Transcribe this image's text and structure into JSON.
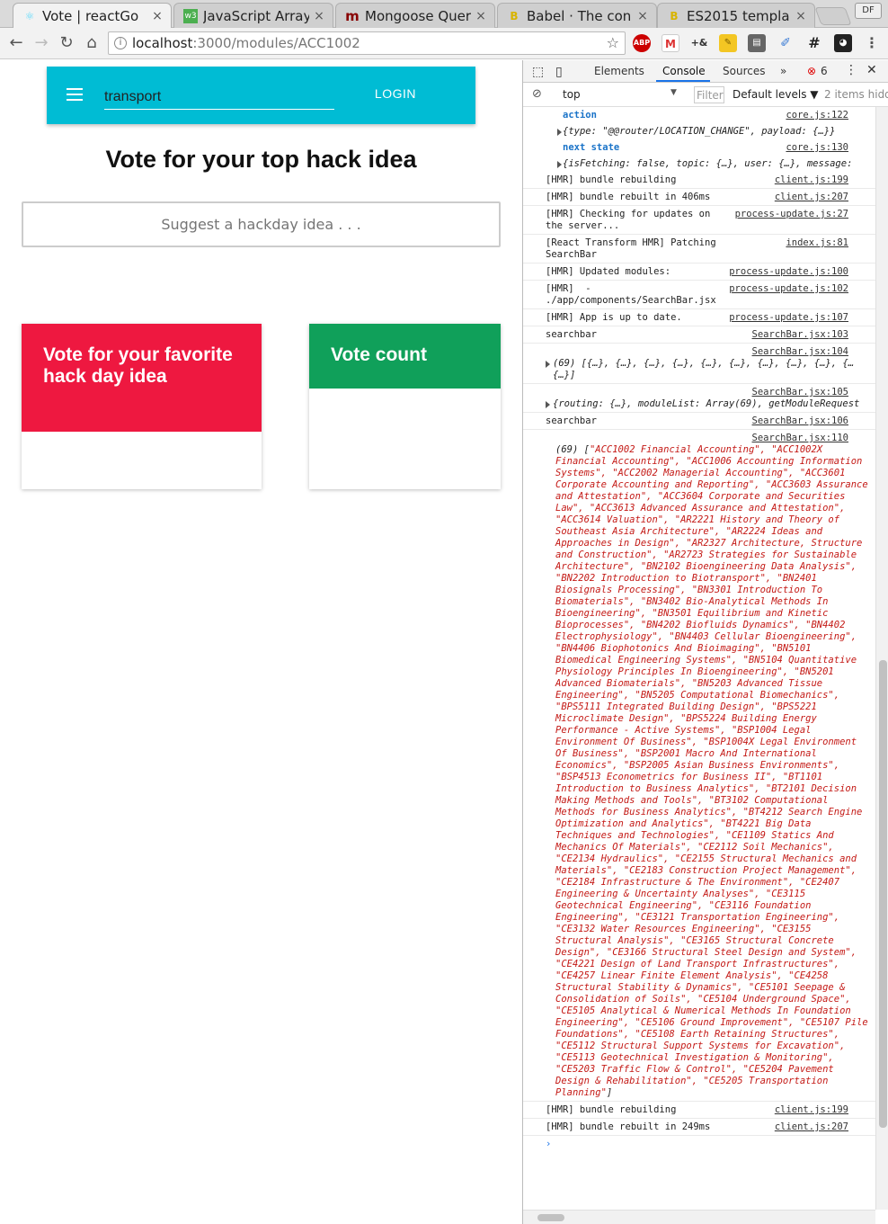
{
  "browser": {
    "tabs": [
      {
        "title": "Vote | reactGo",
        "icon": "react-icon",
        "color": "#61dafb"
      },
      {
        "title": "JavaScript Array",
        "icon": "w3-icon",
        "color": "#4caf50"
      },
      {
        "title": "Mongoose Quer",
        "icon": "mongoose-icon",
        "color": "#880000"
      },
      {
        "title": "Babel · The con",
        "icon": "babel-icon",
        "color": "#f5da55"
      },
      {
        "title": "ES2015 templa",
        "icon": "babel-icon",
        "color": "#f5da55"
      }
    ],
    "profile": "DF",
    "url_host": "localhost",
    "url_path": ":3000/modules/ACC1002"
  },
  "page": {
    "search_value": "transport",
    "login_label": "LOGIN",
    "heading": "Vote for your top hack idea",
    "idea_placeholder": "Suggest a hackday idea . . .",
    "card_ideas_title": "Vote for your favorite hack day idea",
    "card_count_title": "Vote count"
  },
  "devtools": {
    "tabs": [
      "Elements",
      "Console",
      "Sources",
      "»"
    ],
    "active_tab": "Console",
    "error_count": "6",
    "context": "top",
    "filter_placeholder": "Filter",
    "levels": "Default levels ▼",
    "hidden": "2 items hidd",
    "log": [
      {
        "msg": "action",
        "src": "core.js:122",
        "style": "blue",
        "indent": true
      },
      {
        "msg": "{type: \"@@router/LOCATION_CHANGE\", payload: {…}}",
        "src": "",
        "style": "it",
        "indent": true,
        "tri": true
      },
      {
        "msg": "next state",
        "src": "core.js:130",
        "style": "blue",
        "indent": true
      },
      {
        "msg": "{isFetching: false, topic: {…}, user: {…}, message:",
        "src": "",
        "style": "it",
        "indent": true,
        "tri": true
      },
      {
        "msg": "[HMR] bundle rebuilding",
        "src": "client.js:199"
      },
      {
        "msg": "[HMR] bundle rebuilt in 406ms",
        "src": "client.js:207"
      },
      {
        "msg": "[HMR] Checking for updates on\nthe server...",
        "src": "process-update.js:27"
      },
      {
        "msg": "[React Transform HMR] Patching\nSearchBar",
        "src": "index.js:81"
      },
      {
        "msg": "[HMR] Updated modules:",
        "src": "process-update.js:100"
      },
      {
        "msg": "[HMR]  -\n./app/components/SearchBar.jsx",
        "src": "process-update.js:102"
      },
      {
        "msg": "[HMR] App is up to date.",
        "src": "process-update.js:107"
      },
      {
        "msg": "searchbar",
        "src": "SearchBar.jsx:103"
      },
      {
        "msg": "\n(69) [{…}, {…}, {…}, {…}, {…}, {…}, {…}, {…}, {…}, {…\n{…}]",
        "src": "SearchBar.jsx:104",
        "style": "it",
        "tri": true
      },
      {
        "msg": "\n{routing: {…}, moduleList: Array(69), getModuleRequest",
        "src": "SearchBar.jsx:105",
        "style": "it",
        "tri": true
      },
      {
        "msg": "searchbar",
        "src": "SearchBar.jsx:106"
      }
    ],
    "big_log_src": "SearchBar.jsx:110",
    "big_log_prefix": "(69) [",
    "big_log_items": "\"ACC1002 Financial Accounting\", \"ACC1002X Financial Accounting\", \"ACC1006 Accounting Information Systems\", \"ACC2002 Managerial Accounting\", \"ACC3601 Corporate Accounting and Reporting\", \"ACC3603 Assurance and Attestation\", \"ACC3604 Corporate and Securities Law\", \"ACC3613 Advanced Assurance and Attestation\", \"ACC3614 Valuation\", \"AR2221 History and Theory of Southeast Asia Architecture\", \"AR2224 Ideas and Approaches in Design\", \"AR2327 Architecture, Structure and Construction\", \"AR2723 Strategies for Sustainable Architecture\", \"BN2102 Bioengineering Data Analysis\", \"BN2202 Introduction to Biotransport\", \"BN2401 Biosignals Processing\", \"BN3301 Introduction To Biomaterials\", \"BN3402 Bio-Analytical Methods In Bioengineering\", \"BN3501 Equilibrium and Kinetic Bioprocesses\", \"BN4202 Biofluids Dynamics\", \"BN4402 Electrophysiology\", \"BN4403 Cellular Bioengineering\", \"BN4406 Biophotonics And Bioimaging\", \"BN5101 Biomedical Engineering Systems\", \"BN5104 Quantitative Physiology Principles In Bioengineering\", \"BN5201 Advanced Biomaterials\", \"BN5203 Advanced Tissue Engineering\", \"BN5205 Computational Biomechanics\", \"BPS5111 Integrated Building Design\", \"BPS5221 Microclimate Design\", \"BPS5224 Building Energy Performance - Active Systems\", \"BSP1004 Legal Environment Of Business\", \"BSP1004X Legal Environment Of Business\", \"BSP2001 Macro And International Economics\", \"BSP2005 Asian Business Environments\", \"BSP4513 Econometrics for Business II\", \"BT1101 Introduction to Business Analytics\", \"BT2101 Decision Making Methods and Tools\", \"BT3102 Computational Methods for Business Analytics\", \"BT4212 Search Engine Optimization and Analytics\", \"BT4221 Big Data Techniques and Technologies\", \"CE1109 Statics And Mechanics Of Materials\", \"CE2112 Soil Mechanics\", \"CE2134 Hydraulics\", \"CE2155 Structural Mechanics and Materials\", \"CE2183 Construction Project Management\", \"CE2184 Infrastructure & The Environment\", \"CE2407 Engineering & Uncertainty Analyses\", \"CE3115 Geotechnical Engineering\", \"CE3116 Foundation Engineering\", \"CE3121 Transportation Engineering\", \"CE3132 Water Resources Engineering\", \"CE3155 Structural Analysis\", \"CE3165 Structural Concrete Design\", \"CE3166 Structural Steel Design and System\", \"CE4221 Design of Land Transport Infrastructures\", \"CE4257 Linear Finite Element Analysis\", \"CE4258 Structural Stability & Dynamics\", \"CE5101 Seepage & Consolidation of Soils\", \"CE5104 Underground Space\", \"CE5105 Analytical & Numerical Methods In Foundation Engineering\", \"CE5106 Ground Improvement\", \"CE5107 Pile Foundations\", \"CE5108 Earth Retaining Structures\", \"CE5112 Structural Support Systems for Excavation\", \"CE5113 Geotechnical Investigation & Monitoring\", \"CE5203 Traffic Flow & Control\", \"CE5204 Pavement Design & Rehabilitation\", \"CE5205 Transportation Planning\"",
    "big_log_suffix": "]",
    "tail_log": [
      {
        "msg": "[HMR] bundle rebuilding",
        "src": "client.js:199"
      },
      {
        "msg": "[HMR] bundle rebuilt in 249ms",
        "src": "client.js:207"
      }
    ],
    "prompt": "›"
  }
}
